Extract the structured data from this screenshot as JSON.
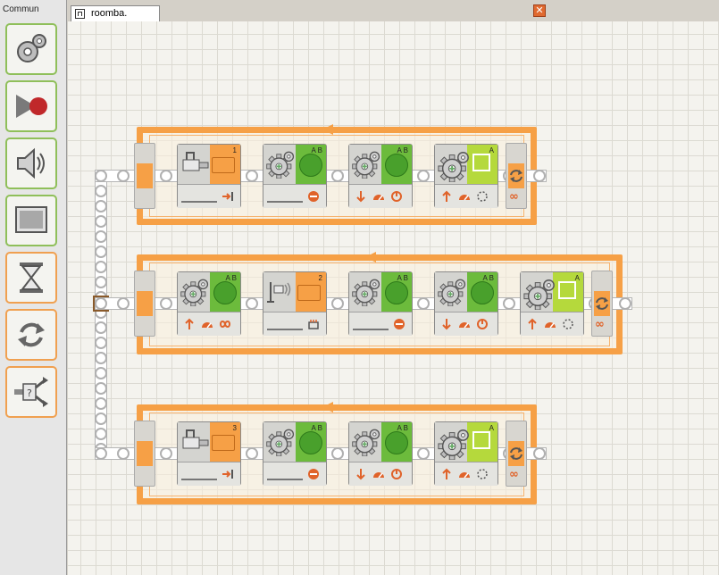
{
  "palette": {
    "title": "Commun",
    "items": [
      {
        "name": "palette-move-block",
        "icon": "gears-icon",
        "color": "green"
      },
      {
        "name": "palette-record-play-block",
        "icon": "record-icon",
        "color": "green"
      },
      {
        "name": "palette-sound-block",
        "icon": "speaker-icon",
        "color": "green"
      },
      {
        "name": "palette-display-block",
        "icon": "display-icon",
        "color": "green"
      },
      {
        "name": "palette-wait-block",
        "icon": "hourglass-icon",
        "color": "orange"
      },
      {
        "name": "palette-loop-block",
        "icon": "loop-icon",
        "color": "orange"
      },
      {
        "name": "palette-switch-block",
        "icon": "switch-icon",
        "color": "orange"
      }
    ]
  },
  "document": {
    "tab_label": "roomba.",
    "close_symbol": "✕"
  },
  "program": {
    "rows": [
      {
        "blocks": [
          {
            "type": "wait-touch",
            "label": "1"
          },
          {
            "type": "move",
            "ports": "A B",
            "mode": "stop"
          },
          {
            "type": "move",
            "ports": "A B",
            "mode": "reverse-degrees"
          },
          {
            "type": "motor",
            "ports": "A",
            "mode": "forward-degrees"
          }
        ],
        "loop_mode": "∞"
      },
      {
        "blocks": [
          {
            "type": "move",
            "ports": "A B",
            "mode": "forward-unlimited"
          },
          {
            "type": "wait-ultrasonic",
            "label": "2"
          },
          {
            "type": "move",
            "ports": "A B",
            "mode": "stop"
          },
          {
            "type": "move",
            "ports": "A B",
            "mode": "reverse-degrees"
          },
          {
            "type": "motor",
            "ports": "A",
            "mode": "forward-degrees"
          }
        ],
        "loop_mode": "∞"
      },
      {
        "blocks": [
          {
            "type": "wait-touch",
            "label": "3"
          },
          {
            "type": "move",
            "ports": "A B",
            "mode": "stop"
          },
          {
            "type": "move",
            "ports": "A B",
            "mode": "reverse-degrees"
          },
          {
            "type": "motor",
            "ports": "A",
            "mode": "forward-degrees"
          }
        ],
        "loop_mode": "∞"
      }
    ]
  },
  "colors": {
    "loop_orange": "#f6a046",
    "move_green": "#6cbb3c",
    "motor_lime": "#b5d93c",
    "accent_red": "#e06a30"
  }
}
